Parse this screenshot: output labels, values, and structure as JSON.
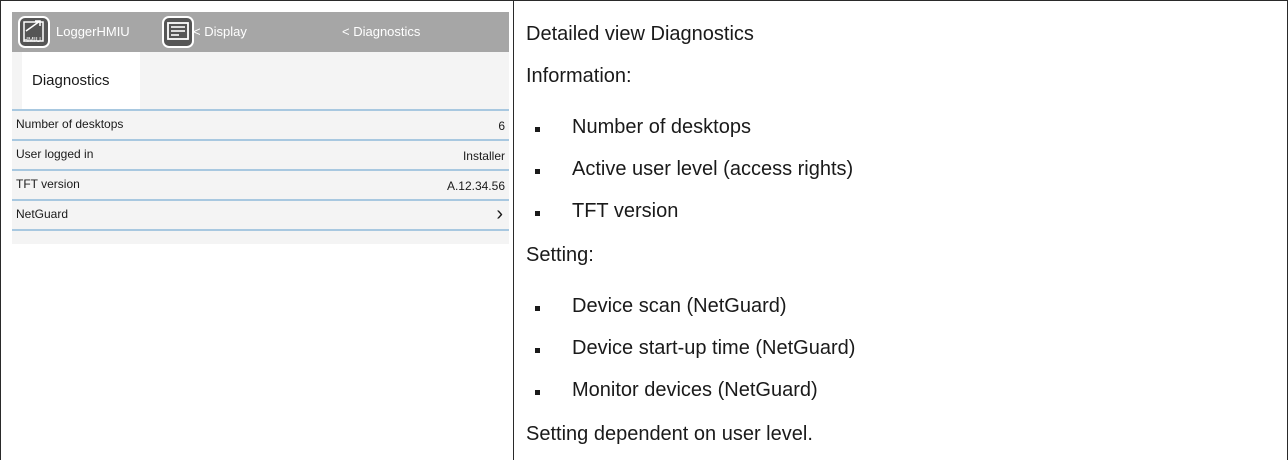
{
  "screen": {
    "title_bar": {
      "hmiu_icon_text": "HMIU",
      "app_name": "LoggerHMIU",
      "display_crumb": "< Display",
      "diagnostics_crumb": "< Diagnostics"
    },
    "tab": {
      "label": "Diagnostics"
    },
    "rows": [
      {
        "label": "Number of desktops",
        "value": "6"
      },
      {
        "label": "User logged in",
        "value": "Installer"
      },
      {
        "label": "TFT version",
        "value": "A.12.34.56"
      },
      {
        "label": "NetGuard",
        "value": "›"
      }
    ]
  },
  "description": {
    "heading": "Detailed view Diagnostics",
    "information_label": "Information:",
    "information_items": [
      "Number of desktops",
      "Active user level (access rights)",
      "TFT version"
    ],
    "setting_label": "Setting:",
    "setting_items": [
      "Device scan (NetGuard)",
      "Device start-up time (NetGuard)",
      "Monitor devices (NetGuard)"
    ],
    "footer": "Setting dependent on user level."
  }
}
